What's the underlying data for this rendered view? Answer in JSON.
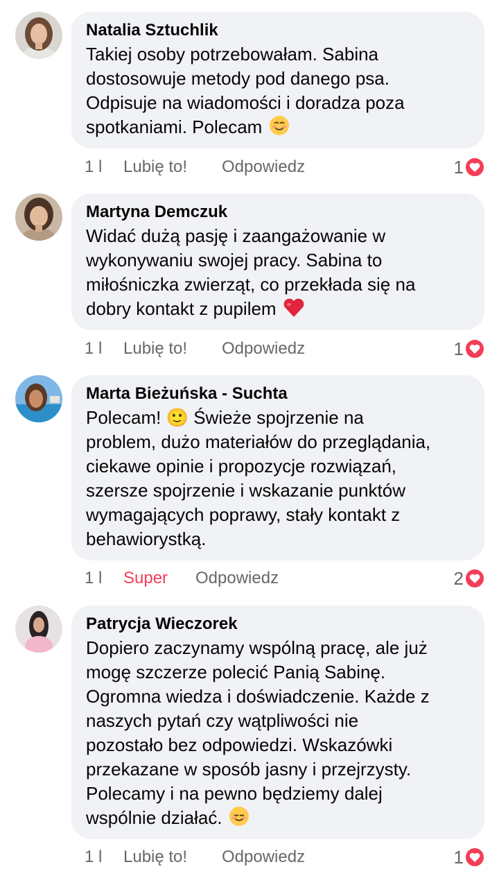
{
  "colors": {
    "bubble": "#f0f2f5",
    "meta_text": "#65676b",
    "super_reaction": "#f33e58",
    "heart_badge": "#f33e58"
  },
  "comments": [
    {
      "author": "Natalia Sztuchlik",
      "lines": [
        "Takiej osoby potrzebowałam. Sabina",
        "dostosowuje metody pod danego psa.",
        "Odpisuje na wiadomości i doradza poza",
        "spotkaniami. Polecam"
      ],
      "trailing_emoji": "smiling-face-with-smiling-eyes",
      "time": "1 l",
      "like_label": "Lubię to!",
      "reply_label": "Odpowiedz",
      "reaction_count": "1",
      "reaction_icon": "love-icon"
    },
    {
      "author": "Martyna Demczuk",
      "lines": [
        "Widać dużą pasję i zaangażowanie w",
        "wykonywaniu swojej pracy. Sabina to",
        "miłośniczka zwierząt, co przekłada się na",
        "dobry kontakt z pupilem"
      ],
      "trailing_emoji": "red-heart",
      "time": "1 l",
      "like_label": "Lubię to!",
      "reply_label": "Odpowiedz",
      "reaction_count": "1",
      "reaction_icon": "love-icon"
    },
    {
      "author": "Marta Bieżuńska - Suchta",
      "lines": [
        "Polecam! 🙂 Świeże spojrzenie na",
        "problem, dużo materiałów do przeglądania,",
        "ciekawe opinie i propozycje rozwiązań,",
        "szersze spojrzenie i wskazanie punktów",
        "wymagających poprawy, stały kontakt z",
        "behawiorystką."
      ],
      "inline_emoji": "slightly-smiling-face",
      "time": "1 l",
      "like_label": "Super",
      "reply_label": "Odpowiedz",
      "reaction_count": "2",
      "reaction_icon": "love-icon"
    },
    {
      "author": "Patrycja Wieczorek",
      "lines": [
        "Dopiero zaczynamy wspólną pracę, ale już",
        "mogę szczerze polecić Panią Sabinę.",
        "Ogromna wiedza i doświadczenie. Każde z",
        "naszych pytań czy wątpliwości nie",
        "pozostało bez odpowiedzi. Wskazówki",
        "przekazane w sposób jasny i przejrzysty.",
        "Polecamy i na pewno będziemy dalej",
        "wspólnie działać."
      ],
      "trailing_emoji": "smiling-face",
      "time": "1 l",
      "like_label": "Lubię to!",
      "reply_label": "Odpowiedz",
      "reaction_count": "1",
      "reaction_icon": "love-icon"
    }
  ]
}
